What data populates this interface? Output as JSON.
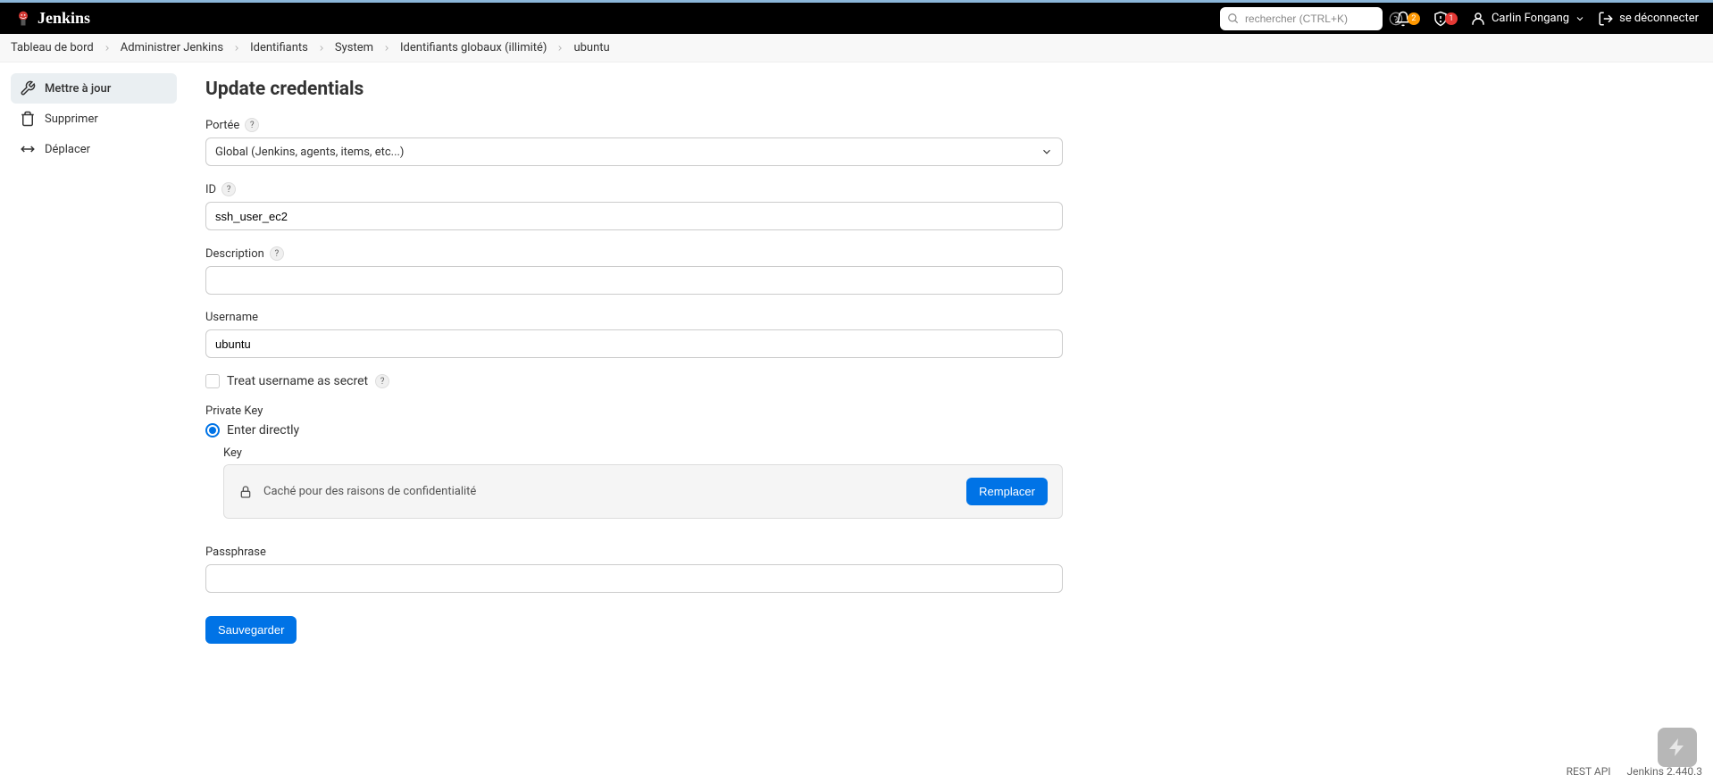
{
  "header": {
    "app_name": "Jenkins",
    "search_placeholder": "rechercher (CTRL+K)",
    "notification_count": "2",
    "alert_count": "1",
    "user_name": "Carlin Fongang",
    "logout_label": "se déconnecter"
  },
  "breadcrumb": {
    "items": [
      "Tableau de bord",
      "Administrer Jenkins",
      "Identifiants",
      "System",
      "Identifiants globaux (illimité)",
      "ubuntu"
    ]
  },
  "sidebar": {
    "items": [
      {
        "label": "Mettre à jour"
      },
      {
        "label": "Supprimer"
      },
      {
        "label": "Déplacer"
      }
    ]
  },
  "page": {
    "title": "Update credentials"
  },
  "form": {
    "scope_label": "Portée",
    "scope_value": "Global (Jenkins, agents, items, etc...)",
    "id_label": "ID",
    "id_value": "ssh_user_ec2",
    "description_label": "Description",
    "description_value": "",
    "username_label": "Username",
    "username_value": "ubuntu",
    "treat_secret_label": "Treat username as secret",
    "private_key_label": "Private Key",
    "enter_directly_label": "Enter directly",
    "key_label": "Key",
    "key_hidden_text": "Caché pour des raisons de confidentialité",
    "replace_button": "Remplacer",
    "passphrase_label": "Passphrase",
    "passphrase_value": "",
    "save_button": "Sauvegarder"
  },
  "footer": {
    "rest_api": "REST API",
    "version": "Jenkins 2.440.3"
  }
}
